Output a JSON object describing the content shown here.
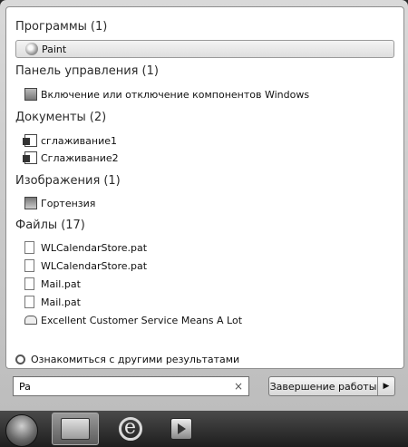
{
  "groups": {
    "programs": {
      "label": "Программы",
      "count": "(1)",
      "items": [
        {
          "label": "Paint",
          "icon": "paint-icon"
        }
      ]
    },
    "control_panel": {
      "label": "Панель управления",
      "count": "(1)",
      "items": [
        {
          "label": "Включение или отключение компонентов Windows",
          "icon": "control-panel-icon"
        }
      ]
    },
    "documents": {
      "label": "Документы",
      "count": "(2)",
      "items": [
        {
          "label": "сглаживание1",
          "icon": "document-icon"
        },
        {
          "label": "Сглаживание2",
          "icon": "document-icon"
        }
      ]
    },
    "images": {
      "label": "Изображения",
      "count": "(1)",
      "items": [
        {
          "label": "Гортензия",
          "icon": "image-icon"
        }
      ]
    },
    "files": {
      "label": "Файлы",
      "count": "(17)",
      "items": [
        {
          "label": "WLCalendarStore.pat",
          "icon": "file-icon"
        },
        {
          "label": "WLCalendarStore.pat",
          "icon": "file-icon"
        },
        {
          "label": "Mail.pat",
          "icon": "file-icon"
        },
        {
          "label": "Mail.pat",
          "icon": "file-icon"
        },
        {
          "label": "Excellent Customer Service Means A Lot",
          "icon": "mail-icon"
        }
      ]
    }
  },
  "see_more": "Ознакомиться с другими результатами",
  "search": {
    "value": "Pa",
    "clear": "×"
  },
  "shutdown": {
    "label": "Завершение работы",
    "arrow": "▶"
  }
}
